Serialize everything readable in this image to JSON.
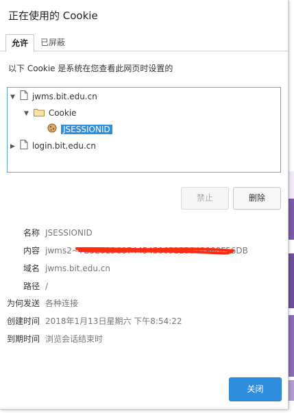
{
  "dialog": {
    "title": "正在使用的 Cookie",
    "tabs": [
      {
        "label": "允许",
        "active": true
      },
      {
        "label": "已屏蔽",
        "active": false
      }
    ],
    "description": "以下 Cookie 是系统在您查看此网页时设置的"
  },
  "tree": {
    "site1": "jwms.bit.edu.cn",
    "folder": "Cookie",
    "cookie": "JSESSIONID",
    "site2": "login.bit.edu.cn"
  },
  "actions": {
    "block": "禁止",
    "delete": "删除",
    "close": "关闭"
  },
  "details": [
    {
      "label": "名称",
      "value": "JSESSIONID"
    },
    {
      "label": "内容",
      "value": "jwms2~7B52013C8744545063223842908F56DB"
    },
    {
      "label": "域名",
      "value": "jwms.bit.edu.cn"
    },
    {
      "label": "路径",
      "value": "/"
    },
    {
      "label": "为何发送",
      "value": "各种连接"
    },
    {
      "label": "创建时间",
      "value": "2018年1月13日星期六 下午8:54:22"
    },
    {
      "label": "到期时间",
      "value": "浏览会话结束时"
    }
  ],
  "colors": {
    "accent": "#2f8fde",
    "redaction": "#ff2a10",
    "tree_border": "#5fa9c9"
  }
}
